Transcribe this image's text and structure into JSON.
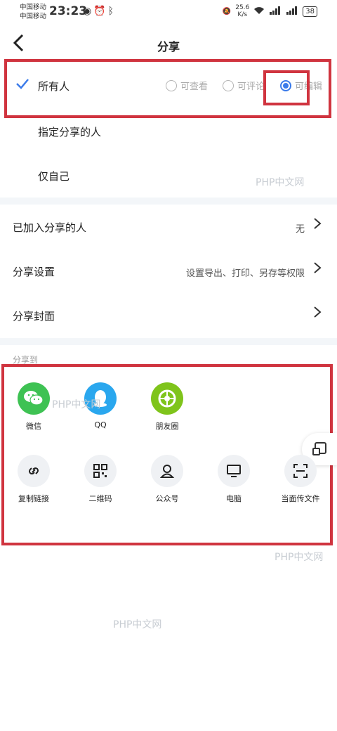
{
  "status_bar": {
    "carrier_1": "中国移动",
    "carrier_2": "中国移动",
    "time": "23:23",
    "speed_value": "25.6",
    "speed_unit": "K/s",
    "battery": "38"
  },
  "header": {
    "title": "分享"
  },
  "permissions": {
    "everyone_label": "所有人",
    "options": [
      "可查看",
      "可评论",
      "可编辑"
    ],
    "selected": "可编辑",
    "specified_label": "指定分享的人",
    "self_label": "仅自己"
  },
  "settings": {
    "joined": {
      "label": "已加入分享的人",
      "value": "无"
    },
    "share_settings": {
      "label": "分享设置",
      "value": "设置导出、打印、另存等权限"
    },
    "cover": {
      "label": "分享封面"
    }
  },
  "share_to": {
    "title": "分享到",
    "row1": [
      {
        "label": "微信",
        "icon": "wechat-icon"
      },
      {
        "label": "QQ",
        "icon": "qq-icon"
      },
      {
        "label": "朋友圈",
        "icon": "moments-icon"
      }
    ],
    "row2": [
      {
        "label": "复制链接",
        "icon": "link-icon"
      },
      {
        "label": "二维码",
        "icon": "qrcode-icon"
      },
      {
        "label": "公众号",
        "icon": "official-account-icon"
      },
      {
        "label": "电脑",
        "icon": "computer-icon"
      },
      {
        "label": "当面传文件",
        "icon": "scan-icon"
      }
    ]
  },
  "watermark": "PHP中文网",
  "colors": {
    "accent": "#3b7bea",
    "highlight": "#d0343f"
  }
}
